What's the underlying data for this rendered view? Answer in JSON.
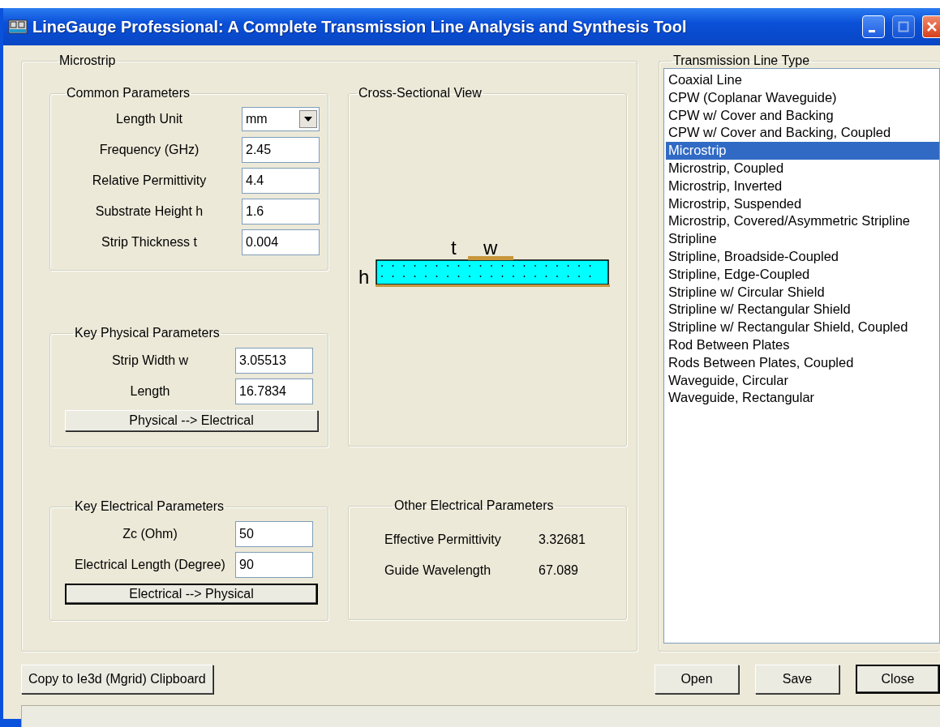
{
  "window": {
    "title": "LineGauge Professional: A Complete Transmission Line Analysis and Synthesis Tool"
  },
  "panel": {
    "title": "Microstrip"
  },
  "common": {
    "title": "Common Parameters",
    "unit": {
      "label": "Length Unit",
      "value": "mm"
    },
    "fields": [
      {
        "label": "Frequency (GHz)",
        "value": "2.45"
      },
      {
        "label": "Relative Permittivity",
        "value": "4.4"
      },
      {
        "label": "Substrate Height h",
        "value": "1.6"
      },
      {
        "label": "Strip Thickness t",
        "value": "0.004"
      }
    ]
  },
  "physical": {
    "title": "Key Physical Parameters",
    "fields": [
      {
        "label": "Strip Width w",
        "value": "3.05513"
      },
      {
        "label": "Length",
        "value": "16.7834"
      }
    ],
    "button": "Physical --> Electrical"
  },
  "electrical": {
    "title": "Key Electrical Parameters",
    "fields": [
      {
        "label": "Zc (Ohm)",
        "value": "50"
      },
      {
        "label": "Electrical Length (Degree)",
        "value": "90"
      }
    ],
    "button": "Electrical --> Physical"
  },
  "cross_section": {
    "title": "Cross-Sectional View",
    "labels": {
      "t": "t",
      "w": "w",
      "h": "h"
    }
  },
  "other": {
    "title": "Other Electrical Parameters",
    "rows": [
      {
        "label": "Effective Permittivity",
        "value": "3.32681"
      },
      {
        "label": "Guide Wavelength",
        "value": "67.089"
      }
    ]
  },
  "line_types": {
    "title": "Transmission Line Type",
    "items": [
      {
        "label": "Coaxial Line",
        "selected": false
      },
      {
        "label": "CPW (Coplanar Waveguide)",
        "selected": false
      },
      {
        "label": "CPW w/ Cover and Backing",
        "selected": false
      },
      {
        "label": "CPW w/ Cover and Backing, Coupled",
        "selected": false
      },
      {
        "label": "Microstrip",
        "selected": true
      },
      {
        "label": "Microstrip, Coupled",
        "selected": false
      },
      {
        "label": "Microstrip, Inverted",
        "selected": false
      },
      {
        "label": "Microstrip, Suspended",
        "selected": false
      },
      {
        "label": "Microstrip, Covered/Asymmetric Stripline",
        "selected": false
      },
      {
        "label": "Stripline",
        "selected": false
      },
      {
        "label": "Stripline, Broadside-Coupled",
        "selected": false
      },
      {
        "label": "Stripline, Edge-Coupled",
        "selected": false
      },
      {
        "label": "Stripline w/ Circular Shield",
        "selected": false
      },
      {
        "label": "Stripline w/ Rectangular Shield",
        "selected": false
      },
      {
        "label": "Stripline w/ Rectangular Shield, Coupled",
        "selected": false
      },
      {
        "label": "Rod Between Plates",
        "selected": false
      },
      {
        "label": "Rods Between Plates, Coupled",
        "selected": false
      },
      {
        "label": "Waveguide, Circular",
        "selected": false
      },
      {
        "label": "Waveguide, Rectangular",
        "selected": false
      }
    ]
  },
  "copy_button": {
    "label": "Copy to Ie3d (Mgrid) Clipboard",
    "default": false
  },
  "buttons": [
    {
      "label": "Open",
      "default": false
    },
    {
      "label": "Save",
      "default": false
    },
    {
      "label": "Close",
      "default": true
    }
  ]
}
